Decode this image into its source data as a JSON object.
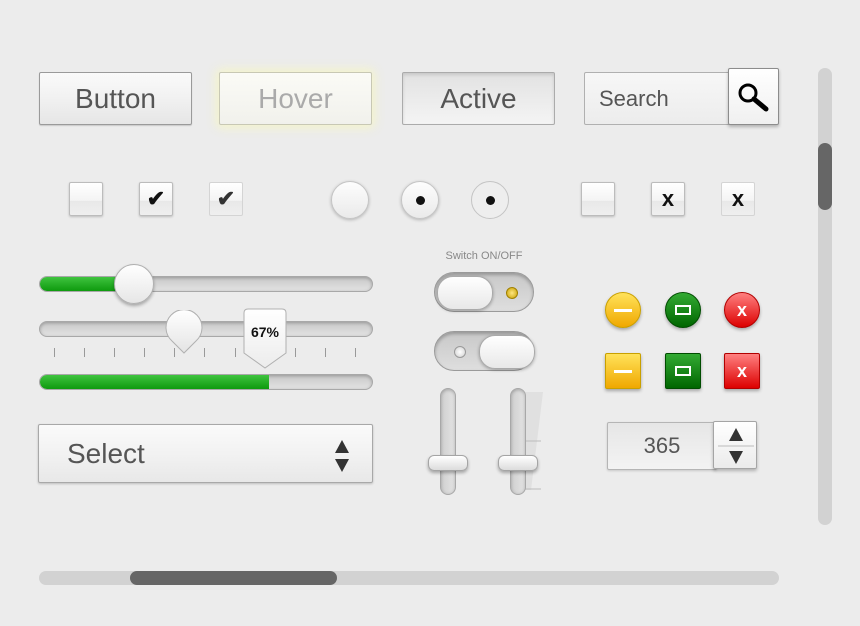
{
  "buttons": {
    "normal": "Button",
    "hover": "Hover",
    "active": "Active"
  },
  "search": {
    "placeholder": "Search"
  },
  "checkboxes": {
    "checked_mark": "✔",
    "x_mark": "x"
  },
  "sliders": {
    "first_percent": 30,
    "progress_percent": 67,
    "progress_label": "67%"
  },
  "switch": {
    "title": "Switch ON/OFF"
  },
  "select": {
    "value": "Select"
  },
  "stepper": {
    "value": "365"
  },
  "colors": {
    "accent_green": "#0e9a0e",
    "yellow": "#f0a800",
    "green": "#006600",
    "red": "#dd0000"
  }
}
